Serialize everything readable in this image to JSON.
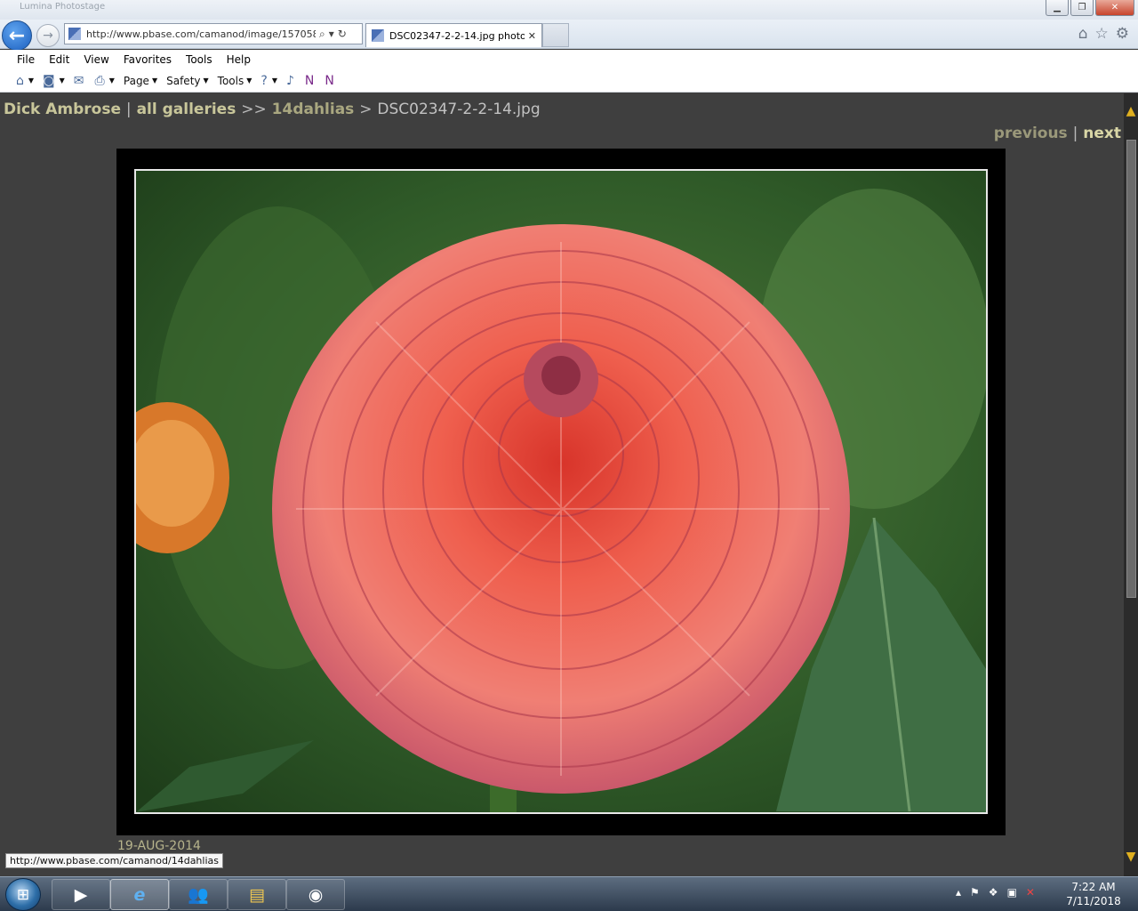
{
  "window": {
    "title": "Lumina Photostage"
  },
  "nav": {
    "address": "http://www.pbase.com/camanod/image/157058",
    "tab_title": "DSC02347-2-2-14.jpg photo..."
  },
  "menu": [
    "File",
    "Edit",
    "View",
    "Favorites",
    "Tools",
    "Help"
  ],
  "cmdbar": {
    "page": "Page",
    "safety": "Safety",
    "tools": "Tools"
  },
  "breadcrumb": {
    "owner": "Dick Ambrose",
    "sep1": "|",
    "galleries": "all galleries",
    "sep2": ">>",
    "gallery": "14dahlias",
    "sep3": ">",
    "current": "DSC02347-2-2-14.jpg"
  },
  "pager": {
    "previous": "previous",
    "sep": "|",
    "next": "next"
  },
  "photo": {
    "date": "19-AUG-2014"
  },
  "status": {
    "link_tip": "http://www.pbase.com/camanod/14dahlias"
  },
  "clock": {
    "time": "7:22 AM",
    "date": "7/11/2018"
  },
  "colors": {
    "page_bg": "#3f3f3f",
    "link": "#c8c69a",
    "accent": "#e0b020"
  }
}
